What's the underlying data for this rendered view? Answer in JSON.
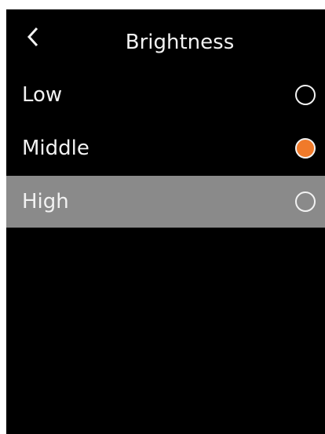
{
  "header": {
    "back_icon": "chevron-left-icon",
    "title": "Brightness"
  },
  "options": [
    {
      "label": "Low",
      "selected": false,
      "highlighted": false
    },
    {
      "label": "Middle",
      "selected": true,
      "highlighted": false
    },
    {
      "label": "High",
      "selected": false,
      "highlighted": true
    }
  ],
  "colors": {
    "background": "#000000",
    "text": "#f2f2f2",
    "accent": "#f07a2a",
    "highlight": "#8a8a8a"
  }
}
